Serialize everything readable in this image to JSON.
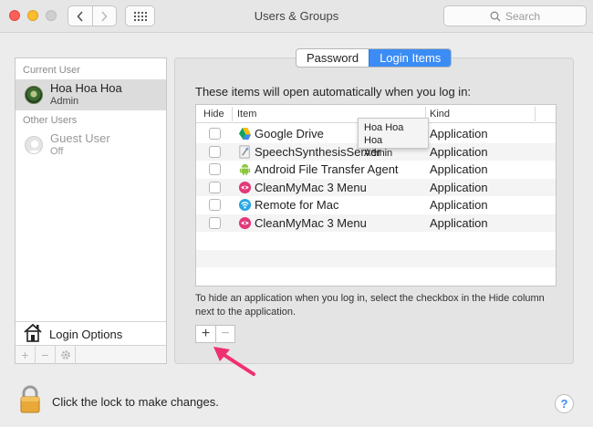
{
  "window": {
    "title": "Users & Groups"
  },
  "toolbar": {
    "search_placeholder": "Search"
  },
  "sidebar": {
    "current_user_heading": "Current User",
    "other_users_heading": "Other Users",
    "users": [
      {
        "name": "Hoa Hoa Hoa",
        "role": "Admin"
      },
      {
        "name": "Guest User",
        "role": "Off"
      }
    ],
    "login_options_label": "Login Options"
  },
  "tabs": [
    {
      "label": "Password"
    },
    {
      "label": "Login Items"
    }
  ],
  "login_items": {
    "intro": "These items will open automatically when you log in:",
    "columns": {
      "hide": "Hide",
      "item": "Item",
      "kind": "Kind"
    },
    "rows": [
      {
        "name": "Google Drive",
        "kind": "Application",
        "icon": "google-drive-icon"
      },
      {
        "name": "SpeechSynthesisServer",
        "kind": "Application",
        "icon": "speech-server-icon"
      },
      {
        "name": "Android File Transfer Agent",
        "kind": "Application",
        "icon": "android-icon"
      },
      {
        "name": "CleanMyMac 3 Menu",
        "kind": "Application",
        "icon": "cleanmymac-icon"
      },
      {
        "name": "Remote for Mac",
        "kind": "Application",
        "icon": "remote-icon"
      },
      {
        "name": "CleanMyMac 3 Menu",
        "kind": "Application",
        "icon": "cleanmymac-icon"
      }
    ],
    "help_text": "To hide an application when you log in, select the checkbox in the Hide column next to the application."
  },
  "tooltip": {
    "line1": "Hoa Hoa Hoa",
    "line2": "Admin"
  },
  "footer": {
    "lock_text": "Click the lock to make changes.",
    "help_label": "?"
  },
  "colors": {
    "accent": "#3b8cf5",
    "arrow": "#f0306e"
  }
}
